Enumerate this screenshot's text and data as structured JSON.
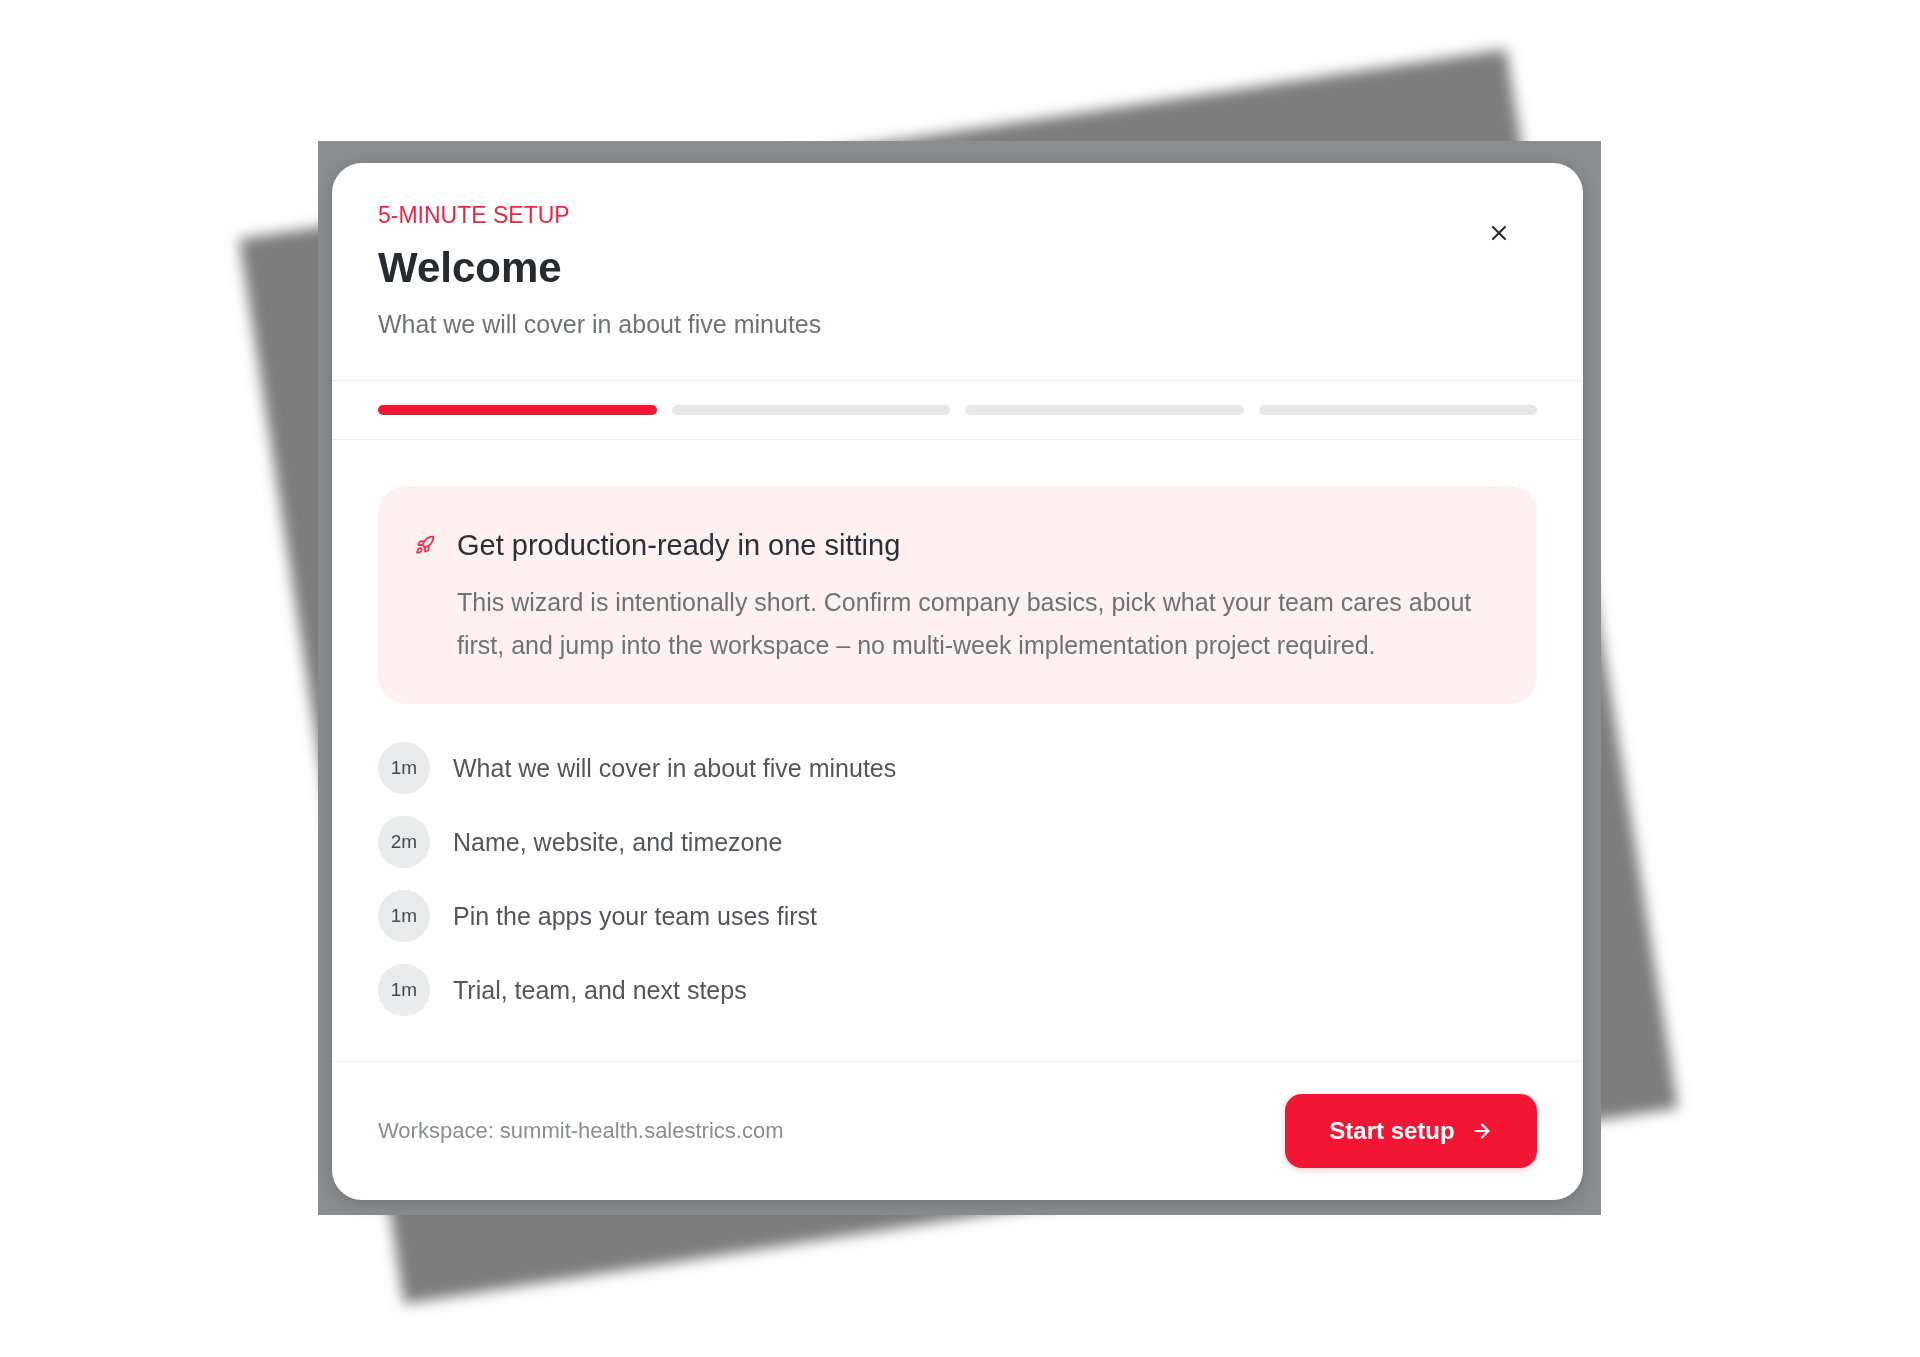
{
  "header": {
    "eyebrow": "5-MINUTE SETUP",
    "title": "Welcome",
    "subtitle": "What we will cover in about five minutes"
  },
  "progress": [
    {
      "complete": true
    },
    {
      "complete": false
    },
    {
      "complete": false
    },
    {
      "complete": false
    }
  ],
  "callout": {
    "title": "Get production-ready in one sitting",
    "body": "This wizard is intentionally short. Confirm company basics, pick what your team cares about first, and jump into the workspace – no multi-week implementation project required."
  },
  "steps": [
    {
      "duration": "1m",
      "label": "What we will cover in about five minutes"
    },
    {
      "duration": "2m",
      "label": "Name, website, and timezone"
    },
    {
      "duration": "1m",
      "label": "Pin the apps your team uses first"
    },
    {
      "duration": "1m",
      "label": "Trial, team, and next steps"
    }
  ],
  "footer": {
    "workspace": "Workspace: summit-health.salestrics.com",
    "button": "Start setup"
  }
}
